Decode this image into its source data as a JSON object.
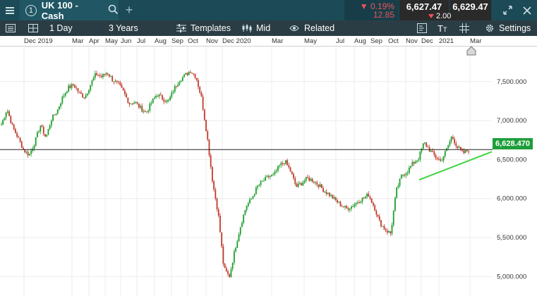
{
  "header": {
    "menu_icon": "hamburger-icon",
    "instrument_number": "1",
    "instrument_name": "UK 100 - Cash",
    "search_icon": "search-icon",
    "add_icon": "plus-icon",
    "change_percent": "0.19%",
    "change_points": "12.85",
    "sell_price": "6,627.47",
    "buy_price": "6,629.47",
    "spread": "2.00",
    "colors": {
      "negative": "#f0525a",
      "bar_bg": "#1c4a56"
    }
  },
  "toolbar": {
    "interval": "1 Day",
    "range": "3 Years",
    "templates": "Templates",
    "price_type": "Mid",
    "related": "Related",
    "settings": "Settings"
  },
  "chart_data": {
    "type": "candlestick",
    "x_labels": [
      "Dec 2019",
      "Mar",
      "Apr",
      "May",
      "Jun",
      "Jul",
      "Aug",
      "Sep",
      "Oct",
      "Nov",
      "Dec 2020",
      "Mar",
      "May",
      "Jul",
      "Aug",
      "Sep",
      "Oct",
      "Nov",
      "Dec",
      "2021",
      "Mar"
    ],
    "y_ticks": [
      "7,500.000",
      "7,000.000",
      "6,500.000",
      "6,000.000",
      "5,500.000",
      "5,000.000"
    ],
    "ylim": [
      4750,
      7950
    ],
    "current_price": 6628.47,
    "current_price_label": "6,628.470",
    "trendline": {
      "from": [
        "Nov 2020",
        6240
      ],
      "to": [
        "Mar 2021",
        6600
      ],
      "color": "#3fd33f"
    },
    "up_color": "#1b9e2b",
    "down_color": "#c0392b",
    "approx_closes": [
      6950,
      7150,
      6920,
      6780,
      6620,
      6560,
      6720,
      6940,
      6780,
      7020,
      7120,
      7300,
      7420,
      7460,
      7350,
      7300,
      7460,
      7600,
      7560,
      7620,
      7520,
      7470,
      7360,
      7220,
      7240,
      7160,
      7100,
      7230,
      7340,
      7280,
      7240,
      7400,
      7520,
      7580,
      7640,
      7560,
      7280,
      6800,
      6200,
      5800,
      5100,
      5000,
      5350,
      5650,
      5900,
      6000,
      6150,
      6220,
      6280,
      6300,
      6420,
      6480,
      6350,
      6150,
      6200,
      6260,
      6230,
      6180,
      6100,
      6050,
      5980,
      5920,
      5870,
      5900,
      5960,
      6000,
      6050,
      5900,
      5700,
      5600,
      5550,
      6100,
      6300,
      6350,
      6450,
      6520,
      6720,
      6620,
      6540,
      6480,
      6620,
      6800,
      6660,
      6580,
      6620
    ]
  }
}
